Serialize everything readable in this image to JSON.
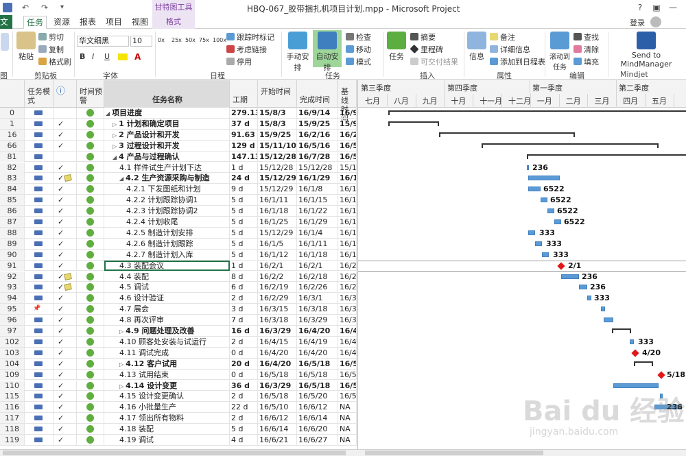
{
  "window": {
    "title": "HBQ-067_胶带捆扎机项目计划.mpp - Microsoft Project",
    "contextual_group": "甘特图工具",
    "sign_in": "登录",
    "help": "?"
  },
  "tabs": {
    "file": "文件",
    "items": [
      "任务",
      "资源",
      "报表",
      "项目",
      "视图"
    ],
    "format": "格式"
  },
  "ribbon": {
    "clipboard": {
      "label": "剪贴板",
      "paste": "粘贴",
      "cut": "剪切",
      "copy": "复制",
      "format_painter": "格式刷"
    },
    "font": {
      "label": "字体",
      "name": "华文细黑",
      "size": "10",
      "bold": "B",
      "italic": "I",
      "underline": "U"
    },
    "schedule": {
      "label": "日程",
      "pcts": [
        "0x",
        "25x",
        "50x",
        "75x",
        "100x"
      ],
      "mark_track": "跟踪时标记",
      "respect_links": "考虑链接",
      "inactivate": "停用"
    },
    "tasks": {
      "label": "任务",
      "manual": "手动安排",
      "auto": "自动安排",
      "inspect": "检查",
      "move": "移动",
      "mode": "模式"
    },
    "insert": {
      "label": "插入",
      "task": "任务",
      "summary": "摘要",
      "milestone": "里程碑",
      "deliverable": "可交付结果"
    },
    "properties": {
      "label": "属性",
      "info": "信息",
      "notes": "备注",
      "details": "详细信息",
      "add_timeline": "添加到日程表"
    },
    "editing": {
      "label": "编辑",
      "scroll_to": "滚动到任务",
      "find": "查找",
      "clear": "清除",
      "fill": "填充"
    },
    "mindjet": {
      "label": "Mindjet",
      "send": "Send to MindManager"
    }
  },
  "grid": {
    "headers": {
      "mode": "任务模式",
      "info": "ⓘ",
      "indicator": "时间预警",
      "name": "任务名称",
      "duration": "工期",
      "start": "开始时间",
      "finish": "完成时间",
      "baseline": "基线时间"
    },
    "rows": [
      {
        "id": "0",
        "name": "项目进度",
        "dur": "279.13",
        "start": "15/8/3",
        "fin": "16/9/14",
        "base": "16/9",
        "level": 0,
        "bold": true,
        "tri": "◢",
        "check": false
      },
      {
        "id": "1",
        "name": "1 计划和确定项目",
        "dur": "37 d",
        "start": "15/8/3",
        "fin": "15/9/25",
        "base": "15/9",
        "level": 1,
        "bold": true,
        "tri": "▷",
        "check": true
      },
      {
        "id": "16",
        "name": "2 产品设计和开发",
        "dur": "91.63 d",
        "start": "15/9/25",
        "fin": "16/2/16",
        "base": "16/2",
        "level": 1,
        "bold": true,
        "tri": "▷",
        "check": true
      },
      {
        "id": "66",
        "name": "3 过程设计和开发",
        "dur": "129 d",
        "start": "15/11/10",
        "fin": "16/5/16",
        "base": "16/5",
        "level": 1,
        "bold": true,
        "tri": "▷",
        "check": true
      },
      {
        "id": "81",
        "name": "4 产品与过程确认",
        "dur": "147.13",
        "start": "15/12/28",
        "fin": "16/7/28",
        "base": "16/5",
        "level": 1,
        "bold": true,
        "tri": "◢",
        "check": false
      },
      {
        "id": "82",
        "name": "4.1 样件试生产计划下达",
        "dur": "1 d",
        "start": "15/12/28",
        "fin": "15/12/28",
        "base": "15/1",
        "level": 2,
        "bold": false,
        "tri": "",
        "check": true
      },
      {
        "id": "83",
        "name": "4.2 生产资源采购与制造",
        "dur": "24 d",
        "start": "15/12/29",
        "fin": "16/1/29",
        "base": "16/1",
        "level": 2,
        "bold": true,
        "tri": "◢",
        "check": true,
        "note": true
      },
      {
        "id": "84",
        "name": "4.2.1 下发图纸和计划",
        "dur": "9 d",
        "start": "15/12/29",
        "fin": "16/1/8",
        "base": "16/1",
        "level": 3,
        "bold": false,
        "tri": "",
        "check": true
      },
      {
        "id": "85",
        "name": "4.2.2 计划跟踪协调1",
        "dur": "5 d",
        "start": "16/1/11",
        "fin": "16/1/15",
        "base": "16/1",
        "level": 3,
        "bold": false,
        "tri": "",
        "check": true
      },
      {
        "id": "86",
        "name": "4.2.3 计划跟踪协调2",
        "dur": "5 d",
        "start": "16/1/18",
        "fin": "16/1/22",
        "base": "16/1",
        "level": 3,
        "bold": false,
        "tri": "",
        "check": true
      },
      {
        "id": "87",
        "name": "4.2.4 计划收尾",
        "dur": "5 d",
        "start": "16/1/25",
        "fin": "16/1/29",
        "base": "16/1",
        "level": 3,
        "bold": false,
        "tri": "",
        "check": true
      },
      {
        "id": "88",
        "name": "4.2.5 制造计划安排",
        "dur": "5 d",
        "start": "15/12/29",
        "fin": "16/1/4",
        "base": "16/1",
        "level": 3,
        "bold": false,
        "tri": "",
        "check": true
      },
      {
        "id": "89",
        "name": "4.2.6 制造计划跟踪",
        "dur": "5 d",
        "start": "16/1/5",
        "fin": "16/1/11",
        "base": "16/1",
        "level": 3,
        "bold": false,
        "tri": "",
        "check": true
      },
      {
        "id": "90",
        "name": "4.2.7 制造计划入库",
        "dur": "5 d",
        "start": "16/1/12",
        "fin": "16/1/18",
        "base": "16/1",
        "level": 3,
        "bold": false,
        "tri": "",
        "check": true
      },
      {
        "id": "91",
        "name": "4.3 装配会议",
        "dur": "1 d",
        "start": "16/2/1",
        "fin": "16/2/1",
        "base": "16/2",
        "level": 2,
        "bold": false,
        "tri": "",
        "check": true,
        "selected": true
      },
      {
        "id": "92",
        "name": "4.4 装配",
        "dur": "8 d",
        "start": "16/2/2",
        "fin": "16/2/18",
        "base": "16/2",
        "level": 2,
        "bold": false,
        "tri": "",
        "check": true,
        "note": true
      },
      {
        "id": "93",
        "name": "4.5 调试",
        "dur": "6 d",
        "start": "16/2/19",
        "fin": "16/2/26",
        "base": "16/2",
        "level": 2,
        "bold": false,
        "tri": "",
        "check": true,
        "note": true
      },
      {
        "id": "94",
        "name": "4.6 设计验证",
        "dur": "2 d",
        "start": "16/2/29",
        "fin": "16/3/1",
        "base": "16/3",
        "level": 2,
        "bold": false,
        "tri": "",
        "check": true
      },
      {
        "id": "95",
        "name": "4.7 展会",
        "dur": "3 d",
        "start": "16/3/15",
        "fin": "16/3/18",
        "base": "16/3",
        "level": 2,
        "bold": false,
        "tri": "",
        "check": true,
        "manual": true
      },
      {
        "id": "96",
        "name": "4.8 再次评审",
        "dur": "7 d",
        "start": "16/3/18",
        "fin": "16/3/29",
        "base": "16/3",
        "level": 2,
        "bold": false,
        "tri": "",
        "check": true
      },
      {
        "id": "97",
        "name": "4.9 问题处理及改善",
        "dur": "16 d",
        "start": "16/3/29",
        "fin": "16/4/20",
        "base": "16/4",
        "level": 2,
        "bold": true,
        "tri": "▷",
        "check": true
      },
      {
        "id": "102",
        "name": "4.10 顾客处安装与试运行",
        "dur": "2 d",
        "start": "16/4/15",
        "fin": "16/4/19",
        "base": "16/4",
        "level": 2,
        "bold": false,
        "tri": "",
        "check": true
      },
      {
        "id": "103",
        "name": "4.11 调试完成",
        "dur": "0 d",
        "start": "16/4/20",
        "fin": "16/4/20",
        "base": "16/4",
        "level": 2,
        "bold": false,
        "tri": "",
        "check": true
      },
      {
        "id": "104",
        "name": "4.12 客户试用",
        "dur": "20 d",
        "start": "16/4/20",
        "fin": "16/5/18",
        "base": "16/5",
        "level": 2,
        "bold": true,
        "tri": "▷",
        "check": true
      },
      {
        "id": "109",
        "name": "4.13 试用结束",
        "dur": "0 d",
        "start": "16/5/18",
        "fin": "16/5/18",
        "base": "16/5",
        "level": 2,
        "bold": false,
        "tri": "",
        "check": true
      },
      {
        "id": "110",
        "name": "4.14 设计变更",
        "dur": "36 d",
        "start": "16/3/29",
        "fin": "16/5/18",
        "base": "16/5",
        "level": 2,
        "bold": true,
        "tri": "▷",
        "check": true
      },
      {
        "id": "115",
        "name": "4.15 设计变更确认",
        "dur": "2 d",
        "start": "16/5/18",
        "fin": "16/5/20",
        "base": "16/5",
        "level": 2,
        "bold": false,
        "tri": "",
        "check": true
      },
      {
        "id": "116",
        "name": "4.16 小批量生产",
        "dur": "22 d",
        "start": "16/5/10",
        "fin": "16/6/12",
        "base": "NA",
        "level": 2,
        "bold": false,
        "tri": "",
        "check": true
      },
      {
        "id": "117",
        "name": "4.17 领出所有物料",
        "dur": "2 d",
        "start": "16/6/12",
        "fin": "16/6/14",
        "base": "NA",
        "level": 2,
        "bold": false,
        "tri": "",
        "check": true
      },
      {
        "id": "118",
        "name": "4.18 装配",
        "dur": "5 d",
        "start": "16/6/14",
        "fin": "16/6/20",
        "base": "NA",
        "level": 2,
        "bold": false,
        "tri": "",
        "check": true
      },
      {
        "id": "119",
        "name": "4.19 调试",
        "dur": "4 d",
        "start": "16/6/21",
        "fin": "16/6/27",
        "base": "NA",
        "level": 2,
        "bold": false,
        "tri": "",
        "check": true
      }
    ]
  },
  "gantt": {
    "quarters": [
      "第三季度",
      "第四季度",
      "第一季度",
      "第二季度"
    ],
    "months": [
      "七月",
      "八月",
      "九月",
      "十月",
      "十一月",
      "十二月",
      "一月",
      "二月",
      "三月",
      "四月",
      "五月"
    ],
    "labels": [
      "236",
      "6522",
      "6522",
      "6522",
      "6522",
      "333",
      "333",
      "333",
      "2/1",
      "236",
      "236",
      "333",
      "333",
      "4/20",
      "5/18",
      "236"
    ]
  },
  "watermark": {
    "main": "Bai du 经验",
    "sub": "jingyan.baidu.com"
  },
  "colors": {
    "accent": "#217346",
    "task_bar": "#5b9bd5",
    "milestone": "#e01818",
    "contextual": "#7e3fa0"
  }
}
